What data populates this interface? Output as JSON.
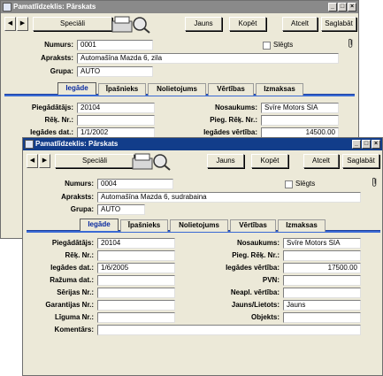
{
  "back_window": {
    "title": "Pamatlīdzeklis: Pārskats",
    "toolbar": {
      "special": "Speciāli",
      "new": "Jauns",
      "copy": "Kopēt",
      "cancel": "Atcelt",
      "save": "Saglabāt"
    },
    "header": {
      "numurs_label": "Numurs:",
      "numurs": "0001",
      "apraksts_label": "Apraksts:",
      "apraksts": "Automašīna Mazda 6, zila",
      "grupa_label": "Grupa:",
      "grupa": "AUTO",
      "sleegts_label": "Slēgts"
    },
    "tabs": [
      "Iegāde",
      "Īpašnieks",
      "Nolietojums",
      "Vērtības",
      "Izmaksas"
    ],
    "fields": {
      "piegadatajs_label": "Piegādātājs:",
      "piegadatajs": "20104",
      "rek_nr_label": "Rēķ. Nr.:",
      "rek_nr": "",
      "iegades_dat_label": "Iegādes dat.:",
      "iegades_dat": "1/1/2002",
      "nosaukums_label": "Nosaukums:",
      "nosaukums": "Svīre Motors SIA",
      "pieg_rek_nr_label": "Pieg. Rēķ. Nr.:",
      "pieg_rek_nr": "",
      "iegades_vertiba_label": "Iegādes vērtība:",
      "iegades_vertiba": "14500.00"
    }
  },
  "front_window": {
    "title": "Pamatlīdzeklis: Pārskats",
    "toolbar": {
      "special": "Speciāli",
      "new": "Jauns",
      "copy": "Kopēt",
      "cancel": "Atcelt",
      "save": "Saglabāt"
    },
    "header": {
      "numurs_label": "Numurs:",
      "numurs": "0004",
      "apraksts_label": "Apraksts:",
      "apraksts": "Automašīna Mazda 6, sudrabaina",
      "grupa_label": "Grupa:",
      "grupa": "AUTO",
      "sleegts_label": "Slēgts"
    },
    "tabs": [
      "Iegāde",
      "Īpašnieks",
      "Nolietojums",
      "Vērtības",
      "Izmaksas"
    ],
    "fields": {
      "piegadatajs_label": "Piegādātājs:",
      "piegadatajs": "20104",
      "rek_nr_label": "Rēķ. Nr.:",
      "rek_nr": "",
      "iegades_dat_label": "Iegādes dat.:",
      "iegades_dat": "1/6/2005",
      "razuma_dat_label": "Ražuma dat.:",
      "razuma_dat": "",
      "serijas_nr_label": "Sērijas Nr.:",
      "serijas_nr": "",
      "garantijas_nr_label": "Garantijas Nr.:",
      "garantijas_nr": "",
      "liguma_nr_label": "Līguma Nr.:",
      "liguma_nr": "",
      "komentars_label": "Komentārs:",
      "komentars": "",
      "nosaukums_label": "Nosaukums:",
      "nosaukums": "Svīre Motors SIA",
      "pieg_rek_nr_label": "Pieg. Rēķ. Nr.:",
      "pieg_rek_nr": "",
      "iegades_vertiba_label": "Iegādes vērtība:",
      "iegades_vertiba": "17500.00",
      "pvn_label": "PVN:",
      "pvn": "",
      "neapl_vertiba_label": "Neapl. vērtība:",
      "neapl_vertiba": "",
      "jauns_lietots_label": "Jauns/Lietots:",
      "jauns_lietots": "Jauns",
      "objekts_label": "Objekts:",
      "objekts": ""
    }
  },
  "title_buttons": {
    "minimize": "_",
    "maximize": "□",
    "close": "×"
  },
  "nav": {
    "prev": "◀",
    "next": "▶"
  },
  "icons": {
    "scanner": "scanner-icon",
    "attachment": "paperclip-icon"
  }
}
